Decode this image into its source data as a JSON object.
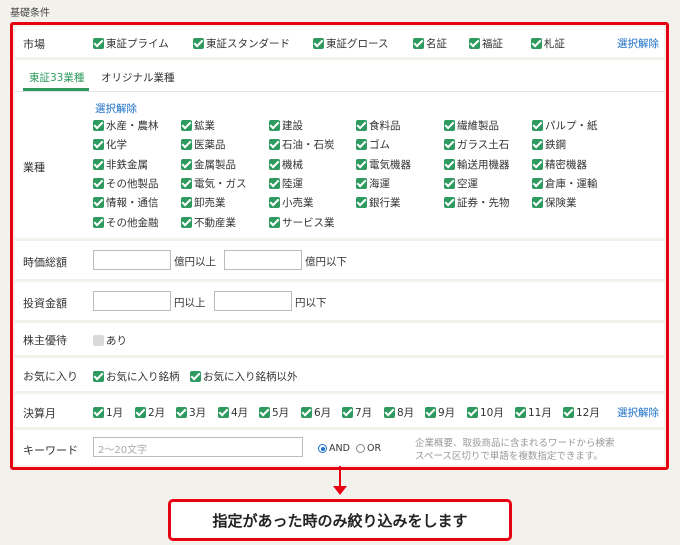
{
  "section_title": "基礎条件",
  "market": {
    "label": "市場",
    "items": [
      "東証プライム",
      "東証スタンダード",
      "東証グロース",
      "名証",
      "福証",
      "札証"
    ],
    "clear_label": "選択解除"
  },
  "industry": {
    "tabs": [
      "東証33業種",
      "オリジナル業種"
    ],
    "active_tab": 0,
    "label": "業種",
    "clear_label": "選択解除",
    "items": [
      "水産・農林",
      "鉱業",
      "建設",
      "食料品",
      "繊維製品",
      "パルプ・紙",
      "化学",
      "医薬品",
      "石油・石炭",
      "ゴム",
      "ガラス土石",
      "鉄鋼",
      "非鉄金属",
      "金属製品",
      "機械",
      "電気機器",
      "輸送用機器",
      "精密機器",
      "その他製品",
      "電気・ガス",
      "陸運",
      "海運",
      "空運",
      "倉庫・運輸",
      "情報・通信",
      "卸売業",
      "小売業",
      "銀行業",
      "証券・先物",
      "保険業",
      "その他金融",
      "不動産業",
      "サービス業"
    ]
  },
  "market_cap": {
    "label": "時価総額",
    "min_suffix": "億円以上",
    "max_suffix": "億円以下",
    "min_value": "",
    "max_value": ""
  },
  "investment": {
    "label": "投資金額",
    "min_suffix": "円以上",
    "max_suffix": "円以下",
    "min_value": "",
    "max_value": ""
  },
  "benefit": {
    "label": "株主優待",
    "option": "あり"
  },
  "favorites": {
    "label": "お気に入り",
    "items": [
      "お気に入り銘柄",
      "お気に入り銘柄以外"
    ]
  },
  "fiscal_month": {
    "label": "決算月",
    "items": [
      "1月",
      "2月",
      "3月",
      "4月",
      "5月",
      "6月",
      "7月",
      "8月",
      "9月",
      "10月",
      "11月",
      "12月"
    ],
    "clear_label": "選択解除"
  },
  "keyword": {
    "label": "キーワード",
    "placeholder": "2〜20文字",
    "and_label": "AND",
    "or_label": "OR",
    "note_line1": "企業概要、取扱商品に含まれるワードから検索",
    "note_line2": "スペース区切りで単語を複数指定できます。"
  },
  "callout": "指定があった時のみ絞り込みをします",
  "colors": {
    "accent_red": "#e60012",
    "check_green": "#2e9a5f",
    "link_blue": "#1a6fc9"
  }
}
